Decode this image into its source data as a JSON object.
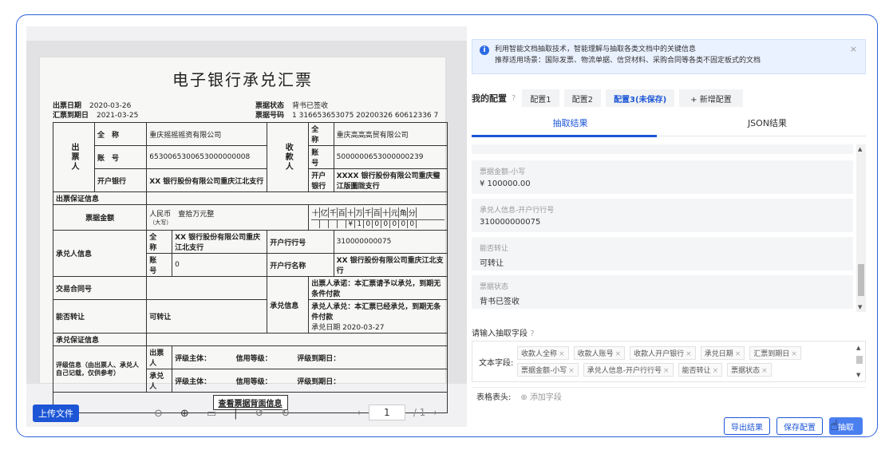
{
  "viewer": {
    "upload_label": "上传文件",
    "page_current": "1",
    "page_total": "/ 1",
    "tool_icons": [
      "zoom-out-icon",
      "zoom-in-icon",
      "fit-icon",
      "divider",
      "rotate-left-icon",
      "rotate-right-icon"
    ]
  },
  "document": {
    "title": "电子银行承兑汇票",
    "issue_date_label": "出票日期",
    "issue_date": "2020-03-26",
    "due_date_label": "汇票到期日",
    "due_date": "2021-03-25",
    "status_label": "票据状态",
    "status": "背书已签收",
    "number_label": "票据号码",
    "number": "1 316653653075 20200326 60612336 7",
    "drawer_label": "出票人",
    "payee_label": "收款人",
    "full_name_label": "全　称",
    "account_label": "账　号",
    "bank_label": "开户银行",
    "drawer_name": "重庆摇摇摇资有限公司",
    "drawer_account": "6530065300653000000008",
    "drawer_bank": "XX 银行股份有限公司重庆江北支行",
    "payee_name": "重庆高高高贸有限公司",
    "payee_account": "5000000653000000239",
    "payee_bank": "XXXX 银行股份有限公司重庆璧江版圖陇支行",
    "guarantee_label": "出票保证信息",
    "amount_label": "票据金额",
    "amount_text": "人民币　壹拾万元整",
    "amount_text_sub": "（大写）",
    "digit_headers": [
      "十",
      "亿",
      "千",
      "百",
      "十",
      "万",
      "千",
      "百",
      "十",
      "元",
      "角",
      "分"
    ],
    "digit_values": [
      "",
      "",
      "",
      "",
      "¥",
      "1",
      "0",
      "0",
      "0",
      "0",
      "0",
      "0"
    ],
    "acceptor_label": "承兑人信息",
    "acceptor_name_label": "全　称",
    "acceptor_name": "XX 银行股份有限公司重庆江北支行",
    "acceptor_account_label": "账　号",
    "acceptor_account": "0",
    "bank_no_label": "开户行行号",
    "bank_no": "310000000075",
    "bank_name_label": "开户行名称",
    "bank_name": "XX 银行股份有限公司重庆江北支行",
    "contract_label": "交易合同号",
    "transfer_label": "能否转让",
    "transfer": "可转让",
    "acceptance_label": "承兑信息",
    "acceptance_1": "出票人承诺：本汇票请予以承兑，到期无条件付款",
    "acceptance_2": "承兑人承兑：本汇票已经承兑，到期无条件付款",
    "acceptance_date": "承兑日期 2020-03-27",
    "accept_guarantee_label": "承兑保证信息",
    "rating_label": "评级信息（由出票人、承兑人自己记载，仅供参考）",
    "rating_drawer": "出票人",
    "rating_acceptor": "承兑人",
    "rating_subject": "评级主体：",
    "rating_level": "信用等级：",
    "rating_due": "评级到期日：",
    "back_button": "查看票据背面信息"
  },
  "info": {
    "line1": "利用智能文档抽取技术，智能理解与抽取各类文档中的关键信息",
    "line2": "推荐适用场景：国际发票、物流单据、信贷材料、采购合同等各类不固定板式的文档"
  },
  "config": {
    "label": "我的配置",
    "tabs": [
      "配置1",
      "配置2",
      "配置3(未保存)"
    ],
    "add_label": "+ 新增配置"
  },
  "subtabs": [
    "抽取结果",
    "JSON结果"
  ],
  "results": [
    {
      "key": "票据金额-小写",
      "value": "¥ 100000.00"
    },
    {
      "key": "承兑人信息-开户行行号",
      "value": "310000000075"
    },
    {
      "key": "能否转让",
      "value": "可转让"
    },
    {
      "key": "票据状态",
      "value": "背书已签收"
    }
  ],
  "fields": {
    "prompt": "请输入抽取字段",
    "text_label": "文本字段:",
    "chips": [
      "收款人全称",
      "收款人账号",
      "收款人开户银行",
      "承兑日期",
      "汇票到期日",
      "票据金额-小写",
      "承兑人信息-开户行行号",
      "能否转让",
      "票据状态"
    ],
    "table_label": "表格表头:",
    "add_field": "添加字段"
  },
  "actions": {
    "export": "导出结果",
    "save": "保存配置",
    "extract": "抽取"
  }
}
